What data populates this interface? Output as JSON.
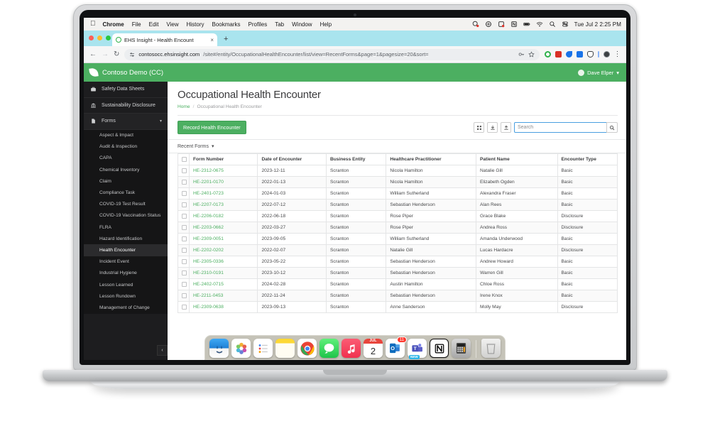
{
  "menubar": {
    "apple": "apple-logo",
    "items": [
      "Chrome",
      "File",
      "Edit",
      "View",
      "History",
      "Bookmarks",
      "Profiles",
      "Tab",
      "Window",
      "Help"
    ],
    "clock": "Tue Jul 2  2:25 PM",
    "status_icons": [
      "dropbox-icon",
      "screen-icon",
      "colorpicker-icon",
      "notion-menu-icon",
      "battery-icon",
      "wifi-icon",
      "spotlight-search-icon",
      "control-center-icon"
    ]
  },
  "browser": {
    "tab_title": "EHS Insight - Health Encount",
    "tab_close": "×",
    "new_tab": "+",
    "back": "←",
    "forward": "→",
    "reload": "↻",
    "url_strong": "contosocc.ehsinsight.com",
    "url_rest": "/site#/entity/OccupationalHealthEncounter/list/view=RecentForms&page=1&pagesize=20&sort=",
    "kebab": "⋮",
    "extension_colors": [
      "#2fb14a",
      "#d93025",
      "#1a73e8",
      "#1a73e8",
      "#ffffff",
      "#8ab4f8",
      "#3c4043"
    ]
  },
  "app": {
    "brand": "Contoso Demo (CC)",
    "user": "Dave Elper",
    "user_caret": "▾",
    "accent_green": "#4caf61"
  },
  "sidebar": {
    "top_items": [
      {
        "label": "Safety Data Sheets",
        "icon": "briefcase-icon"
      },
      {
        "label": "Sustainability Disclosure",
        "icon": "bank-icon"
      },
      {
        "label": "Forms",
        "icon": "document-icon",
        "caret": "▾"
      }
    ],
    "forms_children": [
      "Aspect & Impact",
      "Audit & Inspection",
      "CAPA",
      "Chemical Inventory",
      "Claim",
      "Compliance Task",
      "COVID-19 Test Result",
      "COVID-19 Vaccination Status",
      "FLRA",
      "Hazard Identification",
      "Health Encounter",
      "Incident Event",
      "Industrial Hygiene",
      "Lesson Learned",
      "Lesson Rundown",
      "Management of Change"
    ],
    "active_child": "Health Encounter",
    "collapse": "‹"
  },
  "page": {
    "title": "Occupational Health Encounter",
    "breadcrumb_home": "Home",
    "breadcrumb_sep": "/",
    "breadcrumb_current": "Occupational Health Encounter",
    "primary_button": "Record Health Encounter",
    "filter_label": "Recent Forms",
    "filter_caret": "▾"
  },
  "toolbar": {
    "columns_icon": "columns-grid-icon",
    "download_icon": "download-icon",
    "upload_icon": "upload-icon",
    "search_placeholder": "Search",
    "search_value": "",
    "search_icon": "search-icon"
  },
  "table": {
    "columns": [
      "Form Number",
      "Date of Encounter",
      "Business Entity",
      "Healthcare Practitioner",
      "Patient Name",
      "Encounter Type"
    ],
    "rows": [
      {
        "form_number": "HE-2312-0675",
        "date": "2023-12-11",
        "entity": "Scranton",
        "practitioner": "Nicola Hamilton",
        "patient": "Natalie Gill",
        "type": "Basic"
      },
      {
        "form_number": "HE-2201-0170",
        "date": "2022-01-13",
        "entity": "Scranton",
        "practitioner": "Nicola Hamilton",
        "patient": "Elizabeth Ogden",
        "type": "Basic"
      },
      {
        "form_number": "HE-2401-0723",
        "date": "2024-01-03",
        "entity": "Scranton",
        "practitioner": "William Sutherland",
        "patient": "Alexandra Fraser",
        "type": "Basic"
      },
      {
        "form_number": "HE-2207-0173",
        "date": "2022-07-12",
        "entity": "Scranton",
        "practitioner": "Sebastian Henderson",
        "patient": "Alan Rees",
        "type": "Basic"
      },
      {
        "form_number": "HE-2206-0182",
        "date": "2022-06-18",
        "entity": "Scranton",
        "practitioner": "Rose Piper",
        "patient": "Grace Blake",
        "type": "Disclosure"
      },
      {
        "form_number": "HE-2203-0662",
        "date": "2022-03-27",
        "entity": "Scranton",
        "practitioner": "Rose Piper",
        "patient": "Andrea Ross",
        "type": "Disclosure"
      },
      {
        "form_number": "HE-2309-0051",
        "date": "2023-09-05",
        "entity": "Scranton",
        "practitioner": "William Sutherland",
        "patient": "Amanda Underwood",
        "type": "Basic"
      },
      {
        "form_number": "HE-2202-0202",
        "date": "2022-02-07",
        "entity": "Scranton",
        "practitioner": "Natalie Gill",
        "patient": "Lucas Hardacre",
        "type": "Disclosure"
      },
      {
        "form_number": "HE-2305-0336",
        "date": "2023-05-22",
        "entity": "Scranton",
        "practitioner": "Sebastian Henderson",
        "patient": "Andrew Howard",
        "type": "Basic"
      },
      {
        "form_number": "HE-2310-0191",
        "date": "2023-10-12",
        "entity": "Scranton",
        "practitioner": "Sebastian Henderson",
        "patient": "Warren Gill",
        "type": "Basic"
      },
      {
        "form_number": "HE-2402-0715",
        "date": "2024-02-28",
        "entity": "Scranton",
        "practitioner": "Austin Hamilton",
        "patient": "Chloe Ross",
        "type": "Basic"
      },
      {
        "form_number": "HE-2211-0453",
        "date": "2022-11-24",
        "entity": "Scranton",
        "practitioner": "Sebastian Henderson",
        "patient": "Irene Knox",
        "type": "Basic"
      },
      {
        "form_number": "HE-2309-0638",
        "date": "2023-09-13",
        "entity": "Scranton",
        "practitioner": "Anne Sanderson",
        "patient": "Molly May",
        "type": "Disclosure"
      }
    ]
  },
  "dock": {
    "items": [
      {
        "name": "finder",
        "label": "Finder"
      },
      {
        "name": "photos",
        "label": "Photos"
      },
      {
        "name": "reminders",
        "label": "Reminders"
      },
      {
        "name": "notes",
        "label": "Notes"
      },
      {
        "name": "chrome",
        "label": "Google Chrome"
      },
      {
        "name": "messages",
        "label": "Messages"
      },
      {
        "name": "music",
        "label": "Music"
      },
      {
        "name": "calendar",
        "label": "Calendar",
        "month": "JUL",
        "day": "2"
      },
      {
        "name": "outlook",
        "label": "Outlook",
        "badge": "11"
      },
      {
        "name": "teams",
        "label": "Microsoft Teams",
        "tag": "NEW"
      },
      {
        "name": "notion",
        "label": "Notion"
      },
      {
        "name": "calculator",
        "label": "Calculator"
      },
      {
        "name": "trash",
        "label": "Trash"
      }
    ]
  }
}
